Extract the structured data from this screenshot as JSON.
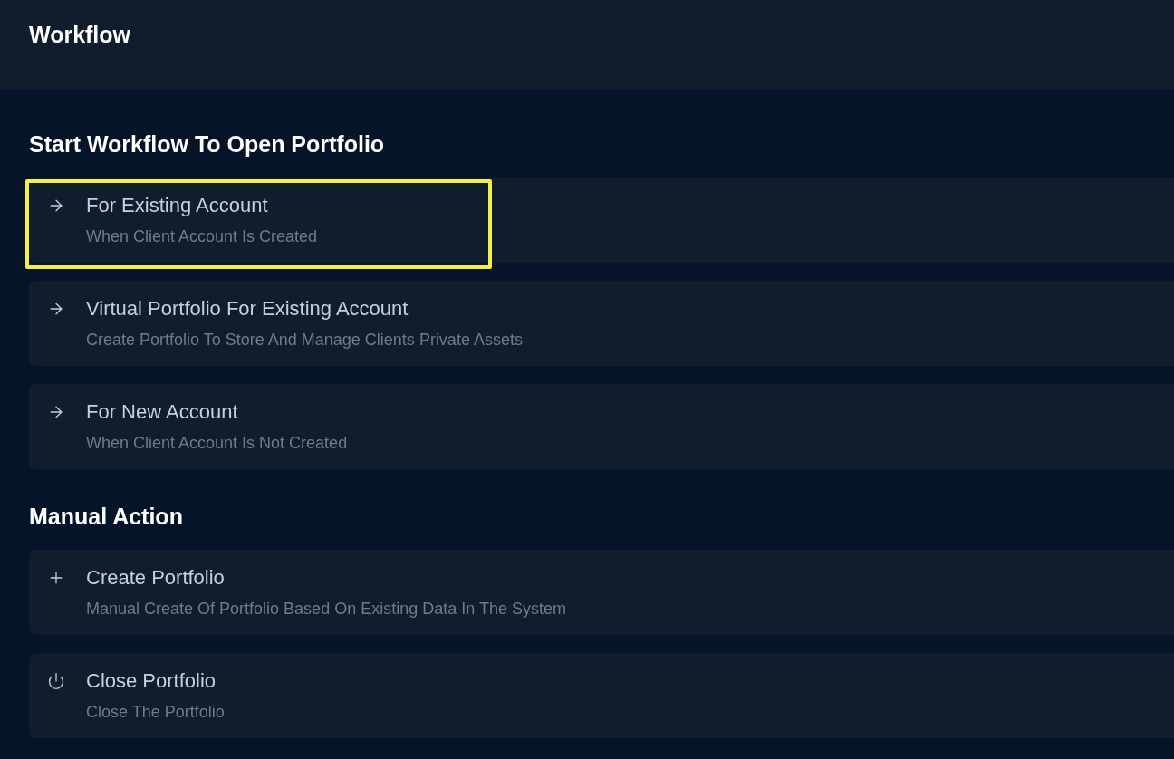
{
  "header": {
    "title": "Workflow"
  },
  "sections": [
    {
      "title": "Start Workflow To Open Portfolio",
      "items": [
        {
          "kind": "arrow",
          "title": "For Existing Account",
          "subtitle": "When Client Account Is Created",
          "highlighted": true
        },
        {
          "kind": "arrow",
          "title": "Virtual Portfolio For Existing Account",
          "subtitle": "Create Portfolio To Store And Manage Clients Private Assets",
          "highlighted": false
        },
        {
          "kind": "arrow",
          "title": "For New Account",
          "subtitle": "When Client Account Is Not Created",
          "highlighted": false
        }
      ]
    },
    {
      "title": "Manual Action",
      "items": [
        {
          "kind": "plus",
          "title": "Create Portfolio",
          "subtitle": "Manual Create Of Portfolio Based On Existing Data In The System",
          "highlighted": false
        },
        {
          "kind": "power",
          "title": "Close Portfolio",
          "subtitle": "Close The Portfolio",
          "highlighted": false
        }
      ]
    }
  ]
}
